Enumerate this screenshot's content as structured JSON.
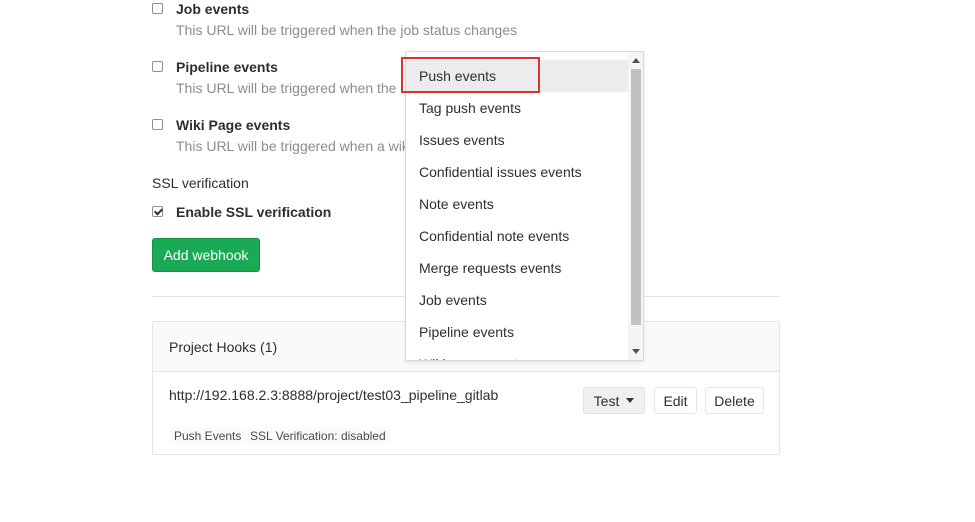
{
  "triggers": [
    {
      "label": "Job events",
      "help": "This URL will be triggered when the job status changes",
      "checked": false
    },
    {
      "label": "Pipeline events",
      "help": "This URL will be triggered when the",
      "checked": false
    },
    {
      "label": "Wiki Page events",
      "help": "This URL will be triggered when a wik",
      "checked": false
    }
  ],
  "ssl": {
    "section_label": "SSL verification",
    "enable_label": "Enable SSL verification",
    "checked": true
  },
  "add_webhook_label": "Add webhook",
  "project_hooks": {
    "title": "Project Hooks (1)",
    "hooks": [
      {
        "url": "http://192.168.2.3:8888/project/test03_pipeline_gitlab",
        "badges": [
          "Push Events",
          "SSL Verification: disabled"
        ],
        "test_label": "Test",
        "edit_label": "Edit",
        "delete_label": "Delete"
      }
    ]
  },
  "test_dropdown": {
    "items": [
      "Push events",
      "Tag push events",
      "Issues events",
      "Confidential issues events",
      "Note events",
      "Confidential note events",
      "Merge requests events",
      "Job events",
      "Pipeline events",
      "Wiki page events"
    ],
    "selected_index": 0
  },
  "colors": {
    "add_button": "#1aaa55",
    "highlight_border": "#d9342b",
    "help_text": "#8c8c8c"
  }
}
